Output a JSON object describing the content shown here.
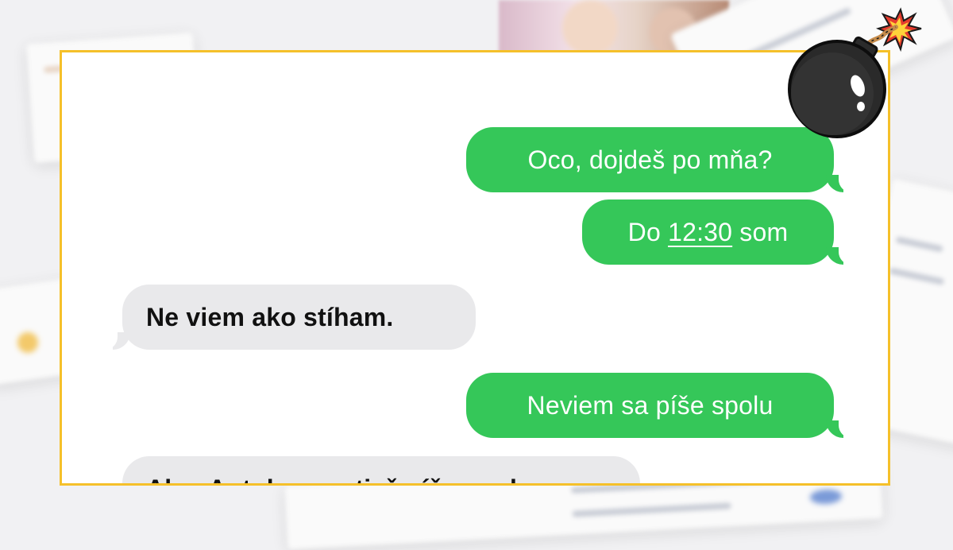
{
  "messages": [
    {
      "side": "sent",
      "text_parts": [
        "Oco, dojdeš po mňa?"
      ]
    },
    {
      "side": "sent",
      "text_before": "Do ",
      "text_link": "12:30",
      "text_after": " som"
    },
    {
      "side": "recv",
      "text_parts": [
        "Ne viem ako stíham."
      ]
    },
    {
      "side": "sent",
      "text_parts": [
        "Neviem sa píše spolu"
      ]
    },
    {
      "side": "recv",
      "text_parts": [
        "Aha. Autobus sa tiež píše spolu"
      ]
    }
  ],
  "colors": {
    "frame_border": "#f5c02a",
    "sent_bubble": "#35c759",
    "recv_bubble": "#e9e9eb"
  },
  "decorations": {
    "corner_icon": "bomb-icon"
  }
}
